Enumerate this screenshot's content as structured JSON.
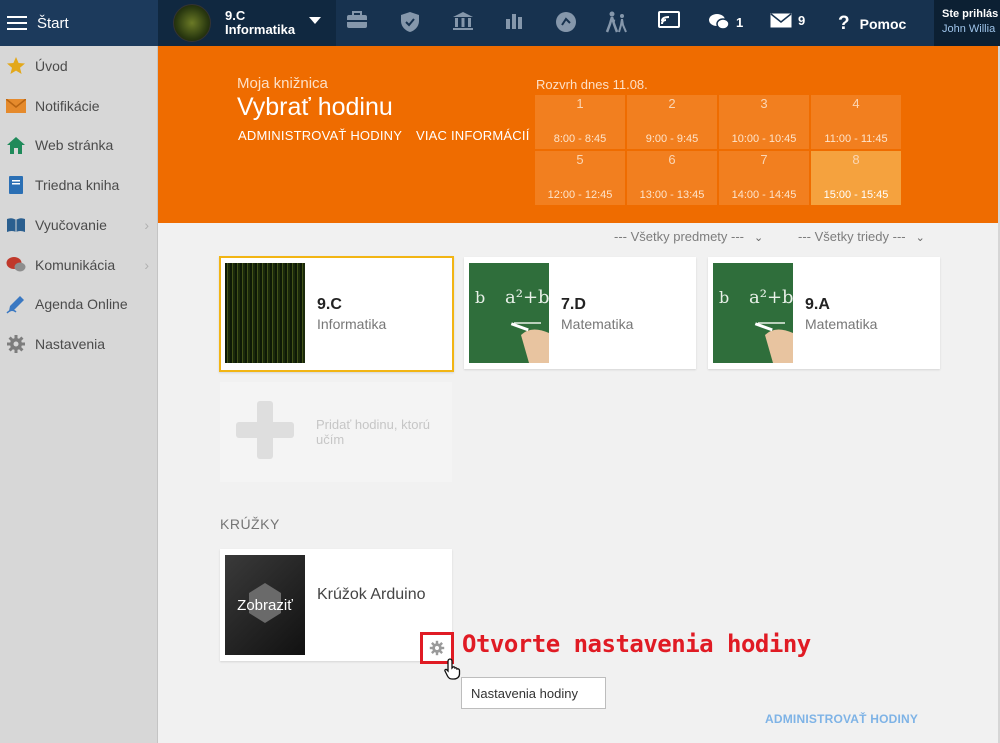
{
  "topbar": {
    "menu_label": "Štart",
    "current_class": "9.C",
    "current_subject": "Informatika",
    "comments_count": "1",
    "messages_count": "9",
    "help_label": "Pomoc",
    "user_line1": "Ste prihlás",
    "user_line2": "John Willia"
  },
  "sidebar": {
    "items": [
      {
        "label": "Úvod",
        "icon": "star-icon"
      },
      {
        "label": "Notifikácie",
        "icon": "envelope-icon"
      },
      {
        "label": "Web stránka",
        "icon": "home-icon"
      },
      {
        "label": "Triedna kniha",
        "icon": "book-icon"
      },
      {
        "label": "Vyučovanie",
        "icon": "open-book-icon"
      },
      {
        "label": "Komunikácia",
        "icon": "chat-icon"
      },
      {
        "label": "Agenda Online",
        "icon": "pen-icon"
      },
      {
        "label": "Nastavenia",
        "icon": "gear-icon"
      }
    ]
  },
  "banner": {
    "subtitle": "Moja knižnica",
    "title": "Vybrať hodinu",
    "link_admin": "ADMINISTROVAŤ HODINY",
    "link_info": "VIAC INFORMÁCIÍ",
    "schedule_title": "Rozvrh dnes 11.08.",
    "slots": [
      {
        "n": "1",
        "time": "8:00 - 8:45"
      },
      {
        "n": "2",
        "time": "9:00 - 9:45"
      },
      {
        "n": "3",
        "time": "10:00 - 10:45"
      },
      {
        "n": "4",
        "time": "11:00 - 11:45"
      },
      {
        "n": "5",
        "time": "12:00 - 12:45"
      },
      {
        "n": "6",
        "time": "13:00 - 13:45"
      },
      {
        "n": "7",
        "time": "14:00 - 14:45"
      },
      {
        "n": "8",
        "time": "15:00 - 15:45"
      }
    ]
  },
  "filters": {
    "subjects": "--- Všetky predmety ---",
    "classes": "--- Všetky triedy ---"
  },
  "lessons": [
    {
      "cls": "9.C",
      "subject": "Informatika"
    },
    {
      "cls": "7.D",
      "subject": "Matematika"
    },
    {
      "cls": "9.A",
      "subject": "Matematika"
    }
  ],
  "add_lesson": "Pridať hodinu, ktorú učím",
  "clubs": {
    "section_label": "KRÚŽKY",
    "card_image_label": "Zobraziť",
    "card_name": "Krúžok Arduino"
  },
  "annotation": "Otvorte nastavenia hodiny",
  "tooltip": "Nastavenia hodiny",
  "admin_bottom": "ADMINISTROVAŤ HODINY",
  "colors": {
    "accent": "#ef6c00",
    "nav": "#17324f",
    "annotation": "#e01b24",
    "selected_border": "#f2b514"
  }
}
